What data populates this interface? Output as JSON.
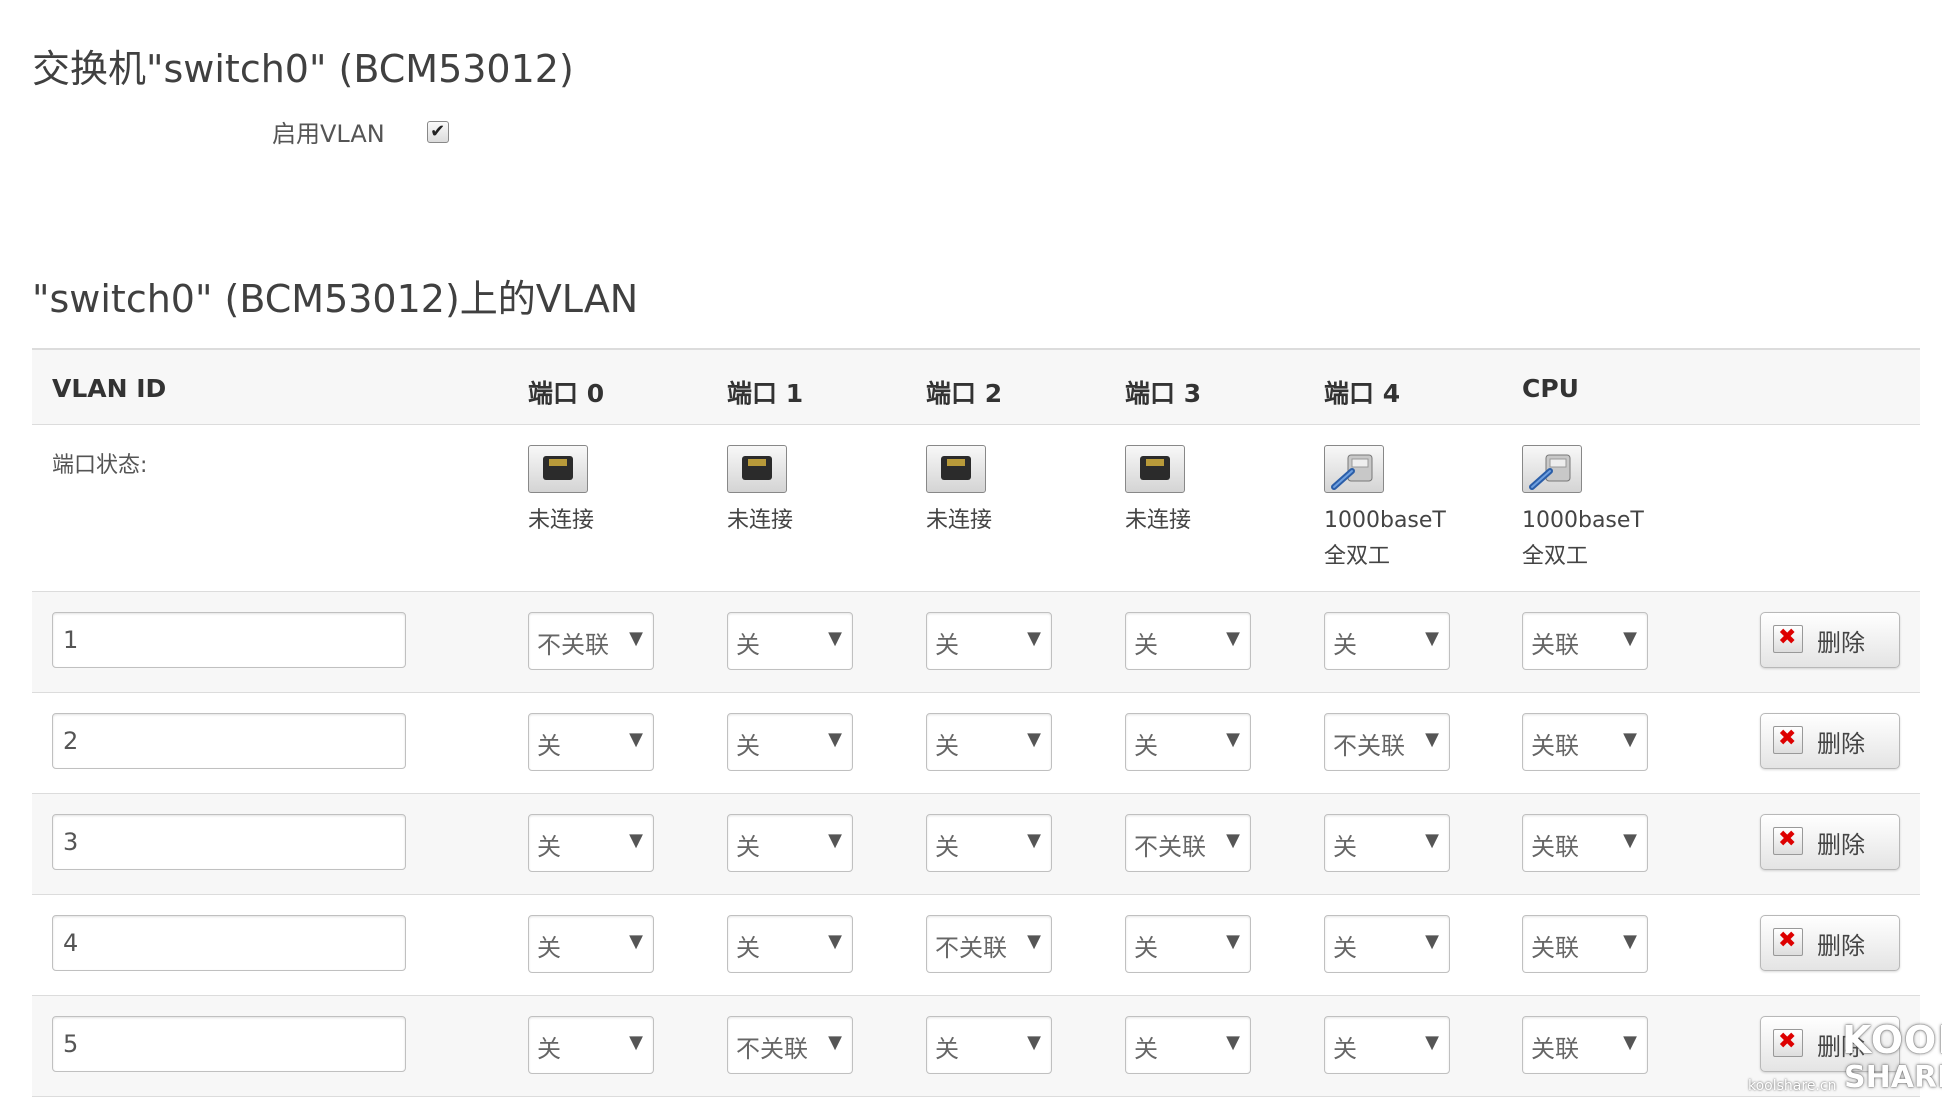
{
  "switch_section": {
    "title": "交换机\"switch0\" (BCM53012)",
    "enable_vlan_label": "启用VLAN",
    "enable_vlan_checked": true
  },
  "vlan_section": {
    "title": "\"switch0\" (BCM53012)上的VLAN",
    "columns": [
      "VLAN ID",
      "端口 0",
      "端口 1",
      "端口 2",
      "端口 3",
      "端口 4",
      "CPU"
    ],
    "port_status_label": "端口状态:",
    "ports": [
      {
        "icon": "port-disconnected-icon",
        "status": "未连接"
      },
      {
        "icon": "port-disconnected-icon",
        "status": "未连接"
      },
      {
        "icon": "port-disconnected-icon",
        "status": "未连接"
      },
      {
        "icon": "port-disconnected-icon",
        "status": "未连接"
      },
      {
        "icon": "port-connected-icon",
        "status": "1000baseT\n全双工"
      },
      {
        "icon": "port-connected-icon",
        "status": "1000baseT\n全双工"
      }
    ],
    "rows": [
      {
        "vlan_id": "1",
        "ports": [
          "不关联",
          "关",
          "关",
          "关",
          "关",
          "关联"
        ]
      },
      {
        "vlan_id": "2",
        "ports": [
          "关",
          "关",
          "关",
          "关",
          "不关联",
          "关联"
        ]
      },
      {
        "vlan_id": "3",
        "ports": [
          "关",
          "关",
          "关",
          "不关联",
          "关",
          "关联"
        ]
      },
      {
        "vlan_id": "4",
        "ports": [
          "关",
          "关",
          "不关联",
          "关",
          "关",
          "关联"
        ]
      },
      {
        "vlan_id": "5",
        "ports": [
          "关",
          "不关联",
          "关",
          "关",
          "关",
          "关联"
        ]
      }
    ],
    "delete_label": "删除"
  },
  "watermark": {
    "line1": "KOOL",
    "line2": "SHARE",
    "url": "koolshare.cn"
  }
}
